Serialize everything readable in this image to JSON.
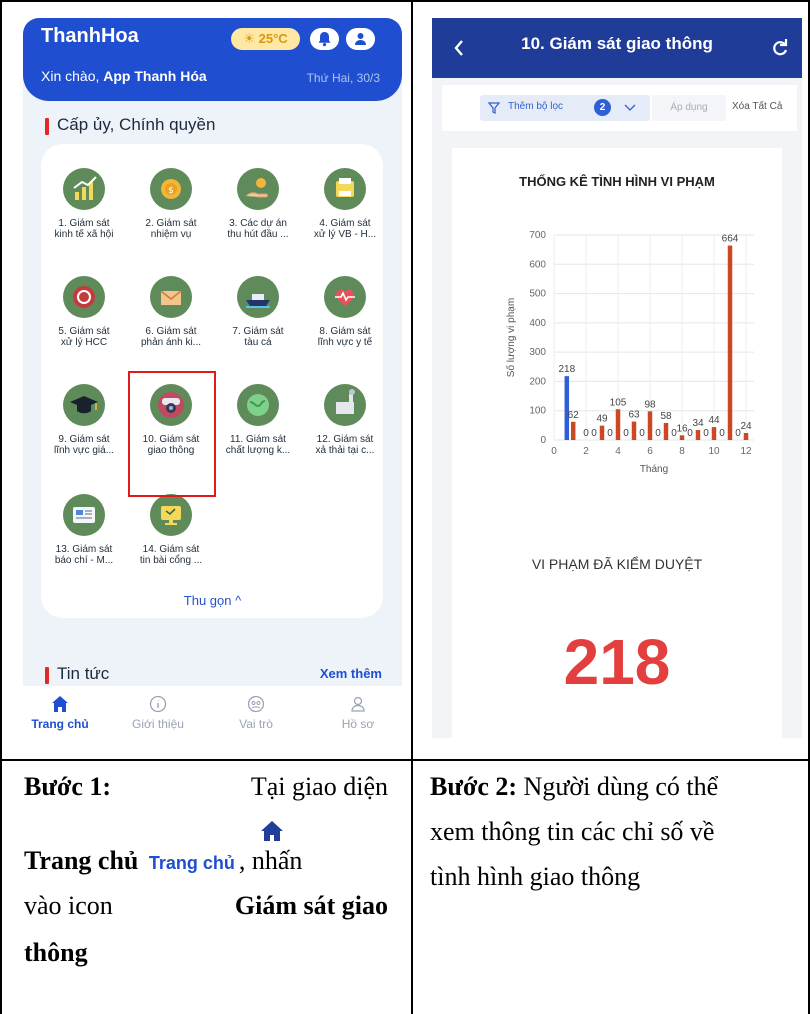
{
  "screen1": {
    "brand": "ThanhHoa",
    "weather": "25°C",
    "greeting_prefix": "Xin chào,",
    "greeting_name": "App Thanh Hóa",
    "date": "Thứ Hai, 30/3",
    "section_title": "Cấp ủy, Chính quyền",
    "tiles": [
      {
        "l1": "1. Giám sát",
        "l2": "kinh tế xã hội",
        "icon": "chart-growth-icon"
      },
      {
        "l1": "2. Giám sát",
        "l2": "nhiệm vụ",
        "icon": "coin-icon"
      },
      {
        "l1": "3. Các dự án",
        "l2": "thu hút đầu ...",
        "icon": "hand-coin-icon"
      },
      {
        "l1": "4. Giám sát",
        "l2": "xử lý VB - H...",
        "icon": "printer-icon"
      },
      {
        "l1": "5. Giám sát",
        "l2": "xử lý HCC",
        "icon": "recycle-hands-icon"
      },
      {
        "l1": "6. Giám sát",
        "l2": "phản ánh ki...",
        "icon": "envelope-icon"
      },
      {
        "l1": "7. Giám sát",
        "l2": "tàu cá",
        "icon": "ship-icon"
      },
      {
        "l1": "8. Giám sát",
        "l2": "lĩnh vực y tế",
        "icon": "heartbeat-icon"
      },
      {
        "l1": "9. Giám sát",
        "l2": "lĩnh vực giá...",
        "icon": "graduation-cap-icon"
      },
      {
        "l1": "10. Giám sát",
        "l2": "giao thông",
        "icon": "security-camera-icon"
      },
      {
        "l1": "11. Giám sát",
        "l2": "chất lượng k...",
        "icon": "globe-leaf-icon"
      },
      {
        "l1": "12. Giám sát",
        "l2": "xả thải tại c...",
        "icon": "factory-icon"
      },
      {
        "l1": "13. Giám sát",
        "l2": "báo chí - M...",
        "icon": "newspaper-icon"
      },
      {
        "l1": "14. Giám sát",
        "l2": "tin bài cổng ...",
        "icon": "monitor-icon"
      }
    ],
    "collapse": "Thu gọn",
    "news_title": "Tin tức",
    "see_more": "Xem thêm",
    "nav": [
      {
        "label": "Trang chủ",
        "icon": "home-icon"
      },
      {
        "label": "Giới thiệu",
        "icon": "info-icon"
      },
      {
        "label": "Vai trò",
        "icon": "role-icon"
      },
      {
        "label": "Hồ sơ",
        "icon": "profile-icon"
      }
    ]
  },
  "screen2": {
    "title": "10. Giám sát giao thông",
    "filter_label": "Thêm bộ lọc",
    "filter_count": "2",
    "apply": "Áp dụng",
    "clear_all": "Xóa Tất Cả",
    "stat_label": "VI PHẠM ĐÃ KIỂM DUYỆT",
    "stat_value": "218"
  },
  "chart_data": {
    "type": "bar",
    "title": "THỐNG KÊ TÌNH HÌNH VI PHẠM",
    "xlabel": "Tháng",
    "ylabel": "Số lượng vi phạm",
    "xlim": [
      0,
      12.5
    ],
    "ylim": [
      0,
      700
    ],
    "xticks": [
      0,
      2,
      4,
      6,
      8,
      10,
      12
    ],
    "yticks": [
      0,
      100,
      200,
      300,
      400,
      500,
      600,
      700
    ],
    "grid": true,
    "series": [
      {
        "color": "#2e5fd6",
        "values": [
          {
            "x": 1,
            "y": 218
          }
        ]
      },
      {
        "color": "#c94a22",
        "values": [
          {
            "x": 1,
            "y": 62
          },
          {
            "x": 2,
            "y": 0
          },
          {
            "x": 2.5,
            "y": 0
          },
          {
            "x": 3,
            "y": 49
          },
          {
            "x": 3.5,
            "y": 0
          },
          {
            "x": 4,
            "y": 105
          },
          {
            "x": 4.5,
            "y": 0
          },
          {
            "x": 5,
            "y": 63
          },
          {
            "x": 5.5,
            "y": 0
          },
          {
            "x": 6,
            "y": 98
          },
          {
            "x": 6.5,
            "y": 0
          },
          {
            "x": 7,
            "y": 58
          },
          {
            "x": 7.5,
            "y": 0
          },
          {
            "x": 8,
            "y": 16
          },
          {
            "x": 8.5,
            "y": 0
          },
          {
            "x": 9,
            "y": 34
          },
          {
            "x": 9.5,
            "y": 0
          },
          {
            "x": 10,
            "y": 44
          },
          {
            "x": 10.5,
            "y": 0
          },
          {
            "x": 11,
            "y": 664
          },
          {
            "x": 11.5,
            "y": 0
          },
          {
            "x": 12,
            "y": 24
          }
        ]
      }
    ]
  },
  "captions": {
    "step1_bold": "Bước 1:",
    "step1_text1": "Tại giao diện",
    "step1_bold2": "Trang chủ",
    "step1_inline": "Trang chủ",
    "step1_text2": ", nhấn",
    "step1_text3": "vào icon",
    "step1_bold3": "Giám sát giao",
    "step1_bold4": "thông",
    "step2_bold": "Bước 2:",
    "step2_line1": "Người dùng có thể",
    "step2_line2": "xem thông tin các chỉ số về",
    "step2_line3": "tình hình giao thông"
  }
}
